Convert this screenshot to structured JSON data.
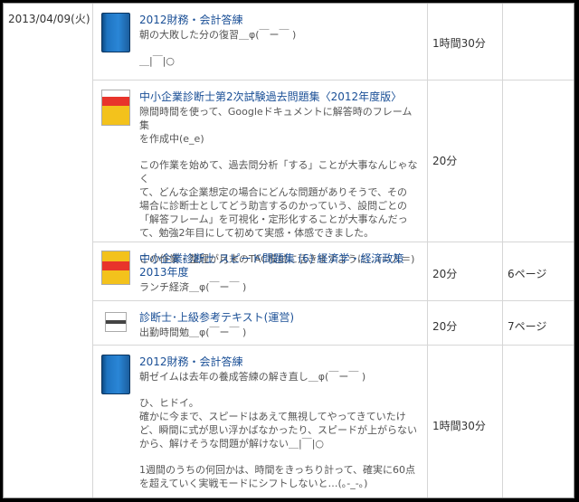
{
  "date": "2013/04/09(火)",
  "rows": [
    {
      "title": "2012財務・会計答練",
      "body": [
        "朝の大敗した分の復習＿φ(￣ー￣ )",
        "",
        "＿|￣|○"
      ],
      "time": "1時間30分",
      "pages": "",
      "icon": "blue-book-icon"
    },
    {
      "title": "中小企業診断士第2次試験過去問題集〈2012年度版〉",
      "body": [
        "隙間時間を使って、Googleドキュメントに解答時のフレーム集",
        "を作成中(e_e)",
        "",
        "この作業を始めて、過去問分析「する」ことが大事なんじゃなく",
        "て、どんな企業想定の場合にどんな問題がありそうで、その",
        "場合に診断士としてどう助言するのかっていう、設問ごとの",
        "「解答フレーム」を可視化・定形化することが大事なんだっ",
        "て、勉強2年目にして初めて実感・体感できました。",
        "",
        "この作業・整理が月末のTAC模試に活きますように…(＝人＝)"
      ],
      "time": "20分",
      "pages": "",
      "icon": "book-cover-icon"
    },
    {
      "title": "中小企業診断士 スピード問題集 (6) 経済学・経済政策 2013年度",
      "body": [
        "ランチ経済＿φ(￣ー￣ )"
      ],
      "time": "20分",
      "pages": "6ページ",
      "icon": "book-cover-icon"
    },
    {
      "title": "診断士･上級参考テキスト(運営)",
      "body": [
        "出勤時間勉＿φ(￣ー￣ )"
      ],
      "time": "20分",
      "pages": "7ページ",
      "icon": "text-book-icon"
    },
    {
      "title": "2012財務・会計答練",
      "body": [
        "朝ゼイムは去年の養成答練の解き直し＿φ(￣ー￣ )",
        "",
        "ひ、ヒドイ。",
        "確かに今まで、スピードはあえて無視してやってきていたけ",
        "ど、瞬間に式が思い浮かばなかったり、スピードが上がらない",
        "から、解けそうな問題が解けない＿|￣|○",
        "",
        "1週間のうちの何回かは、時間をきっちり計って、確実に60点",
        "を超えていく実戦モードにシフトしないと…(｡-_-｡)"
      ],
      "time": "1時間30分",
      "pages": "",
      "icon": "blue-book-icon"
    }
  ]
}
